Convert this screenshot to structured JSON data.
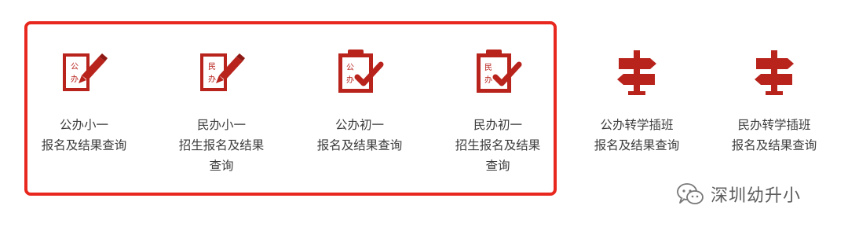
{
  "colors": {
    "icon_red": "#b8231c",
    "frame_red": "#e8281e",
    "label_text": "#3d3d3d"
  },
  "tiles": [
    {
      "icon": "public-school-document-pen-icon",
      "icon_char1": "公",
      "icon_char2": "办",
      "label": "公办小一\n报名及结果查询"
    },
    {
      "icon": "private-school-document-pen-icon",
      "icon_char1": "民",
      "icon_char2": "办",
      "label": "民办小一\n招生报名及结果\n查询"
    },
    {
      "icon": "public-school-clipboard-check-icon",
      "icon_char1": "公",
      "icon_char2": "办",
      "label": "公办初一\n报名及结果查询"
    },
    {
      "icon": "private-school-clipboard-check-icon",
      "icon_char1": "民",
      "icon_char2": "办",
      "label": "民办初一\n招生报名及结果\n查询"
    },
    {
      "icon": "signpost-icon",
      "label": "公办转学插班\n报名及结果查询"
    },
    {
      "icon": "signpost-icon",
      "label": "民办转学插班\n报名及结果查询"
    }
  ],
  "watermark": {
    "icon": "wechat-icon",
    "text": "深圳幼升小"
  }
}
